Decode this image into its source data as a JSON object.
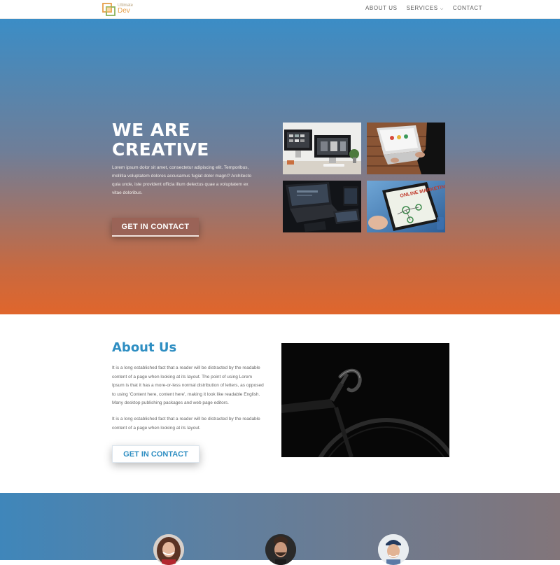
{
  "header": {
    "logo": {
      "line1": "Ultimate",
      "line2": "Dev"
    },
    "nav": [
      {
        "label": "ABOUT US"
      },
      {
        "label": "SERVICES"
      },
      {
        "label": "CONTACT"
      }
    ]
  },
  "hero": {
    "title_line1": "WE ARE",
    "title_line2": "CREATIVE",
    "text": "Lorem ipsum dolor sit amet, consectetur adipiscing elit. Temporibus, mollitia voluptatem dolores accusamus fugiat dolor magni? Architecto quia unde, iste provident officia illum delectus quae a voluptatem ex vitae doloribus.",
    "button": "GET IN CONTACT",
    "tile4_caption": "ONLINE MARKETING"
  },
  "about": {
    "title": "About Us",
    "p1": "It is a long established fact that a reader will be distracted by the readable content of a page when looking at its layout. The point of using Lorem Ipsum is that it has a more-or-less normal distribution of letters, as opposed to using 'Content here, content here', making it look like readable English. Many desktop publishing packages and web page editors.",
    "p2": "It is a long established fact that a reader will be distracted by the readable content of a page when looking at its layout.",
    "button": "GET IN CONTACT"
  },
  "colors": {
    "accent_blue": "#2e8ec2",
    "hero_top": "#3b8dc6",
    "hero_bottom": "#e0662c",
    "logo_orange": "#e6a04a"
  }
}
